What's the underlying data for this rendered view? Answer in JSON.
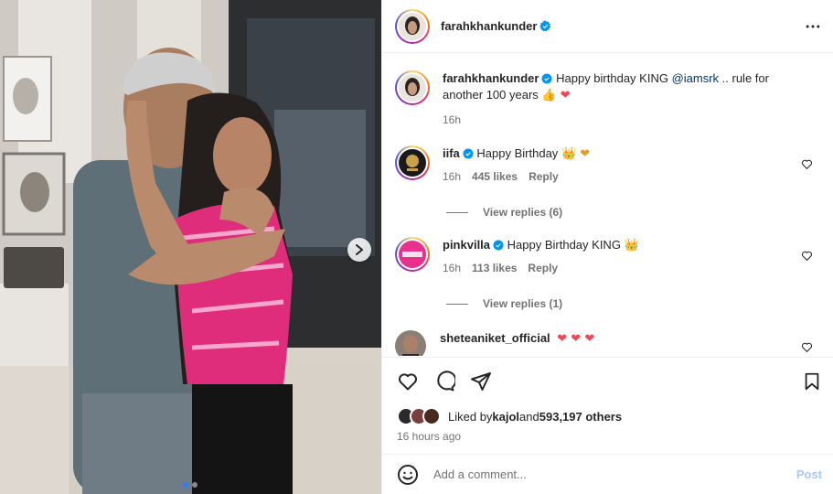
{
  "post": {
    "author": "farahkhankunder",
    "caption_user": "farahkhankunder",
    "caption_text": "Happy birthday KING ",
    "caption_mention": "@iamsrk",
    "caption_rest": " .. rule for another 100 years",
    "caption_emojis": "👍 ❤",
    "caption_time": "16h"
  },
  "comments": [
    {
      "user": "iifa",
      "text": "Happy Birthday",
      "emojis": "👑 ❤",
      "time": "16h",
      "likes": "445 likes",
      "reply": "Reply",
      "view_replies": "View replies (6)"
    },
    {
      "user": "pinkvilla",
      "text": "Happy Birthday KING",
      "emojis": "👑",
      "time": "16h",
      "likes": "113 likes",
      "reply": "Reply",
      "view_replies": "View replies (1)"
    },
    {
      "user": "sheteaniket_official",
      "text": "",
      "emojis": "❤ ❤ ❤"
    }
  ],
  "likes": {
    "prefix": "Liked by ",
    "user": "kajol",
    "middle": " and ",
    "count": "593,197 others"
  },
  "time_ago": "16 hours ago",
  "add_comment": {
    "placeholder": "Add a comment...",
    "post_label": "Post"
  },
  "colors": {
    "accent": "#0095f6",
    "verified": "#0095f6",
    "heart": "#ed4956"
  },
  "icons": [
    "more-icon",
    "heart-icon",
    "comment-icon",
    "share-icon",
    "bookmark-icon",
    "emoji-icon",
    "verified-icon",
    "chevron-right-icon"
  ],
  "carousel": {
    "slides": 2,
    "current": 1
  }
}
